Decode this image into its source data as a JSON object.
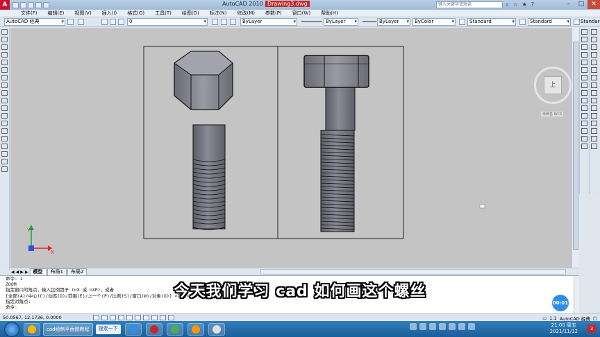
{
  "window": {
    "app_title": "AutoCAD 2010",
    "document_title": "Drawing3.dwg",
    "search_placeholder": "键入关键字或短语"
  },
  "menubar": {
    "items": [
      "文件(F)",
      "编辑(E)",
      "视图(V)",
      "插入(I)",
      "格式(O)",
      "工具(T)",
      "绘图(D)",
      "标注(N)",
      "修改(M)",
      "参数(P)",
      "窗口(W)",
      "帮助(H)"
    ]
  },
  "toolbar": {
    "workspace": "AutoCAD 经典",
    "layer": "0",
    "color": "ByLayer",
    "linetype": "ByLayer",
    "lineweight": "ByLayer",
    "plotstyle": "ByColor",
    "text_style": "Standard",
    "dim_style": "Standard",
    "table_style": "Standard"
  },
  "viewcube": {
    "face_label": "上",
    "wcs_label": "未命名 WCS"
  },
  "tabs": {
    "items": [
      "模型",
      "布局1",
      "布局2"
    ],
    "active": "模型"
  },
  "command_line": {
    "lines": [
      "命令: z",
      "ZOOM",
      "指定窗口的角点，输入比例因子 (nX 或 nXP)，或者",
      "[全部(A)/中心(C)/动态(D)/范围(E)/上一个(P)/比例(S)/窗口(W)/对象(O)] <实时>:",
      "指定对角点:",
      "命令:"
    ]
  },
  "subtitle": "今天我们学习 cad 如何画这个螺丝",
  "timer": "00:01",
  "statusbar": {
    "coords": "50.0567, 12.1736, 0.0000",
    "scale": "1:1",
    "workspace": "AutoCAD 经典"
  },
  "taskbar": {
    "task_label": "cad绘制平面图教程",
    "search_label": "搜索一下",
    "time": "21:00 周五",
    "date": "2021/11/12",
    "notifications": "3"
  },
  "colors": {
    "drawing_background": "#c4c4c4",
    "title_accent": "#c62828",
    "taskbar": "#1b5e99"
  }
}
